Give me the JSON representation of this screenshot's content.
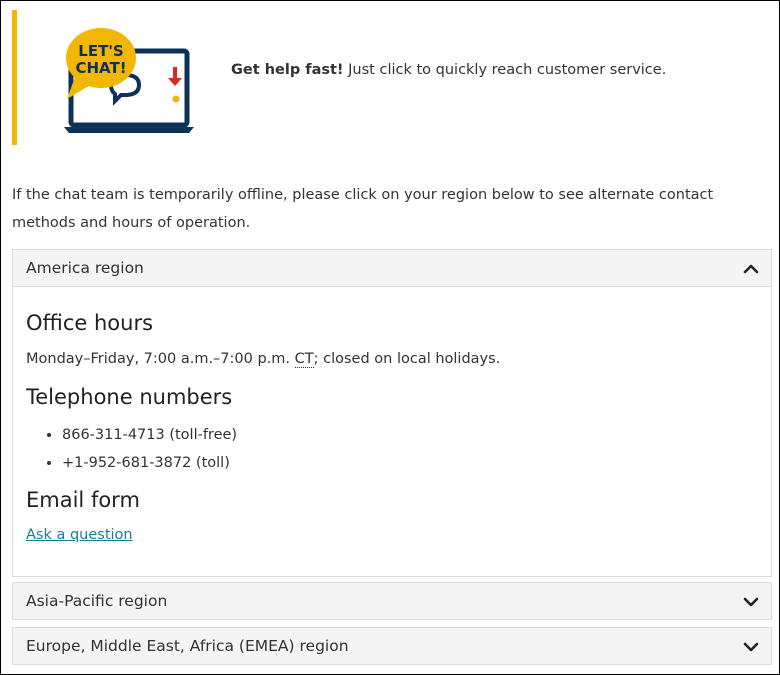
{
  "banner": {
    "bubble_line1": "LET'S",
    "bubble_line2": "CHAT!",
    "bold": "Get help fast!",
    "text": " Just click to quickly reach customer service.",
    "colors": {
      "accent": "#f2b705",
      "navy": "#0d3157",
      "alert": "#e02424"
    }
  },
  "intro": "If the chat team is temporarily offline, please click on your region below to see alternate contact methods and hours of operation.",
  "regions": [
    {
      "label": "America region",
      "expanded": true
    },
    {
      "label": "Asia-Pacific region",
      "expanded": false
    },
    {
      "label": "Europe, Middle East, Africa (EMEA) region",
      "expanded": false
    }
  ],
  "america": {
    "office_hours_heading": "Office hours",
    "hours_prefix": "Monday–Friday, 7:00 a.m.–7:00 p.m. ",
    "timezone": "CT",
    "hours_suffix": "; closed on local holidays.",
    "phone_heading": "Telephone numbers",
    "phones": [
      "866-311-4713 (toll-free)",
      "+1-952-681-3872 (toll)"
    ],
    "email_heading": "Email form",
    "email_link": "Ask a question"
  },
  "icons": {
    "collapse": "chevron-up-icon",
    "expand": "chevron-down-icon"
  }
}
